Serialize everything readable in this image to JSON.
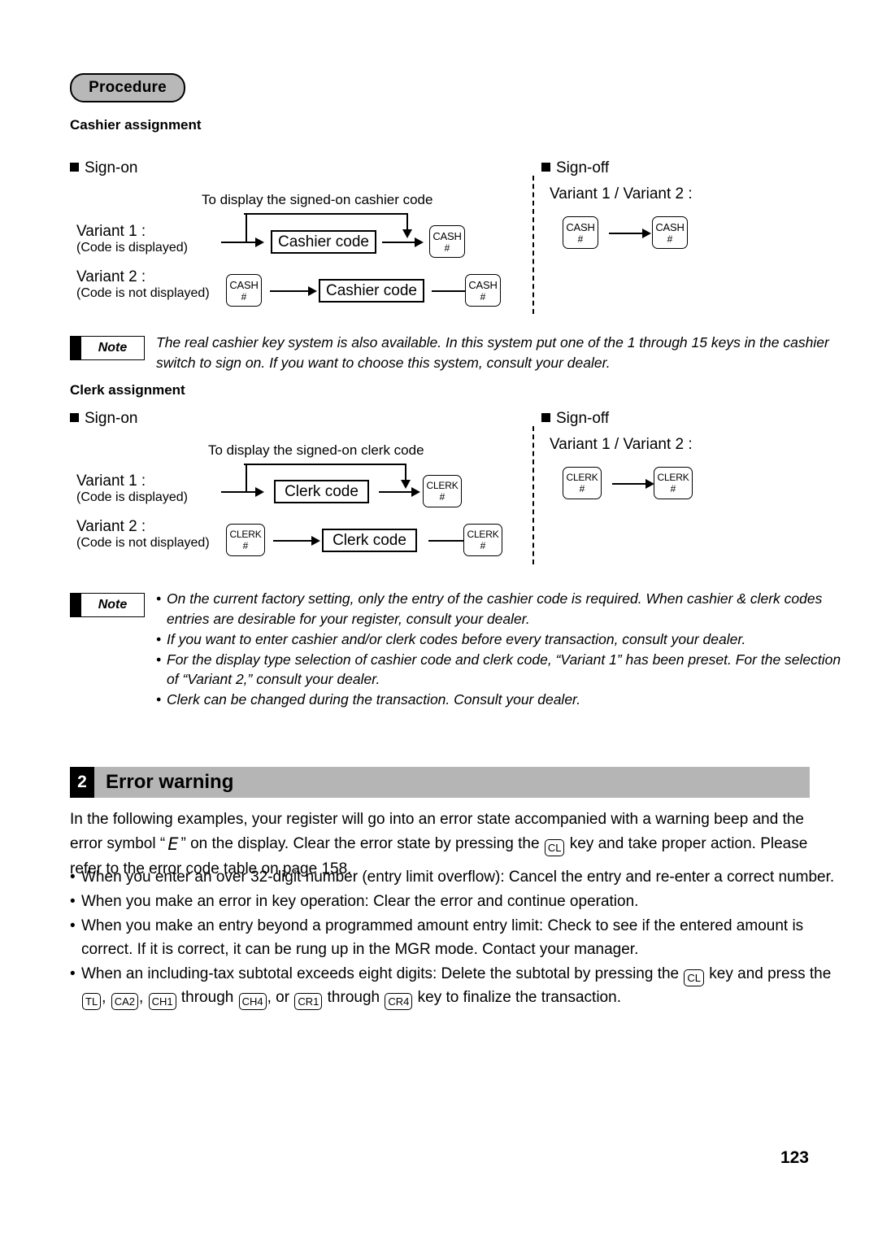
{
  "procedure": {
    "pill_label": "Procedure"
  },
  "cashier": {
    "title": "Cashier assignment",
    "signon_label": "Sign-on",
    "signoff_label": "Sign-off",
    "caption": "To display the signed-on cashier code",
    "variant1_label": "Variant 1 :",
    "variant1_sub": "(Code is displayed)",
    "variant2_label": "Variant 2 :",
    "variant2_sub": "(Code is not displayed)",
    "code_box": "Cashier code",
    "key_label": "CASH",
    "key_sub": "#",
    "signoff_variants": "Variant 1 / Variant 2 :"
  },
  "note1": {
    "badge": "Note",
    "text": "The real cashier key system is also available. In this system put one of the 1 through 15 keys in the cashier switch to sign on. If you want to choose this system, consult your dealer."
  },
  "clerk": {
    "title": "Clerk assignment",
    "signon_label": "Sign-on",
    "signoff_label": "Sign-off",
    "caption": "To display the signed-on clerk code",
    "variant1_label": "Variant 1 :",
    "variant1_sub": "(Code is displayed)",
    "variant2_label": "Variant 2 :",
    "variant2_sub": "(Code is not displayed)",
    "code_box": "Clerk code",
    "key_label": "CLERK",
    "key_sub": "#",
    "signoff_variants": "Variant 1 / Variant 2 :"
  },
  "note2": {
    "badge": "Note",
    "bullets": [
      "On the current factory setting, only the entry of the cashier code is required. When cashier & clerk codes entries are desirable for your register, consult your dealer.",
      "If you want to enter cashier and/or clerk codes before every transaction, consult your dealer.",
      "For the display type selection of cashier code and clerk code, “Variant 1” has been preset. For the selection of “Variant 2,” consult your dealer.",
      "Clerk can be changed during the transaction. Consult your dealer."
    ]
  },
  "section2": {
    "number": "2",
    "title": "Error warning",
    "intro_part1": "In the following examples, your register will go into an error state accompanied with a warning beep and the error symbol “",
    "error_symbol": "E",
    "intro_part2": "” on the display.  Clear the error state by pressing the ",
    "cl_key": "CL",
    "intro_part3": " key and take proper action. Please refer to the error code table on page 158.",
    "bullets": [
      "When you enter an over 32-digit number (entry limit overflow): Cancel the entry and re-enter a correct number.",
      "When you make an error in key operation: Clear the error and continue operation.",
      "When you make an entry beyond a programmed amount entry limit: Check to see if the entered amount is correct.  If it is correct, it can be rung up in the MGR mode.  Contact your manager."
    ],
    "last_bullet": {
      "part1": "When an including-tax subtotal exceeds eight digits: Delete the subtotal by pressing the ",
      "cl_key": "CL",
      "part2": " key and press the ",
      "tl_key": "TL",
      "sep1": ", ",
      "ca2_key": "CA2",
      "sep2": ", ",
      "ch1_key": "CH1",
      "through1": " through ",
      "ch4_key": "CH4",
      "or_text": ", or ",
      "cr1_key": "CR1",
      "through2": " through ",
      "cr4_key": "CR4",
      "part3": " key to finalize the transaction."
    }
  },
  "footer": {
    "page_number": "123"
  },
  "colors": {
    "pill_gray": "#b8b8b8",
    "band_gray": "#b5b5b5",
    "ink": "#000000"
  }
}
